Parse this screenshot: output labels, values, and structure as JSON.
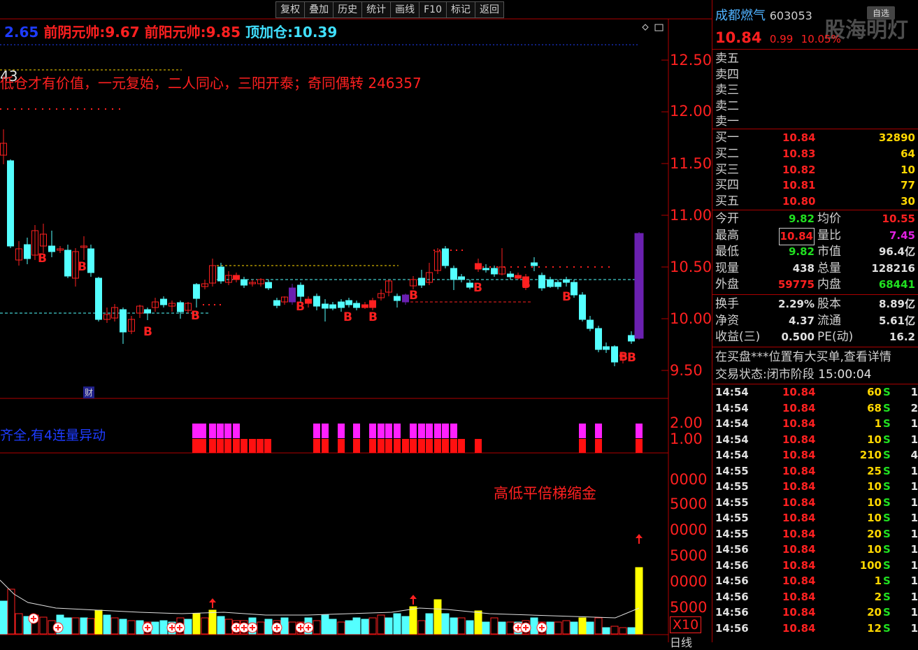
{
  "toolbar": [
    "复权",
    "叠加",
    "历史",
    "统计",
    "画线",
    "F10",
    "标记",
    "返回"
  ],
  "indicator_line": {
    "first_value": "2.65",
    "yin_label": "前阴元帅:",
    "yin_value": "9.67",
    "yang_label": "前阳元帅:",
    "yang_value": "9.85",
    "top_label": "顶加仓:",
    "top_value": "10.39"
  },
  "left_num": "43",
  "note_text": "低仓才有价值，一元复始，二人同心，三阳开泰；奇同偶转 246357",
  "vol_note": "齐全,有4连量异动",
  "gold_label": "高低平倍梯缩金",
  "cai_tag": "财",
  "price_axis": [
    "12.50",
    "12.00",
    "11.50",
    "11.00",
    "10.50",
    "10.00",
    "9.50"
  ],
  "vol_axis": [
    "2.00",
    "1.00"
  ],
  "bottom_axis": [
    "0000",
    "5000",
    "0000",
    "5000",
    "0000",
    "5000"
  ],
  "x10_label": "X10",
  "bottom_partial": "日线",
  "stock": {
    "name": "成都燃气",
    "code": "603053",
    "price": "10.84",
    "change": "0.99",
    "pct": "10.05%",
    "zixuan": "自选",
    "watermark": "股海明灯"
  },
  "sell": [
    "卖五",
    "卖四",
    "卖三",
    "卖二",
    "卖一"
  ],
  "buy": [
    {
      "label": "买一",
      "price": "10.84",
      "vol": "32890"
    },
    {
      "label": "买二",
      "price": "10.83",
      "vol": "64"
    },
    {
      "label": "买三",
      "price": "10.82",
      "vol": "10"
    },
    {
      "label": "买四",
      "price": "10.81",
      "vol": "77"
    },
    {
      "label": "买五",
      "price": "10.80",
      "vol": "30"
    }
  ],
  "stats": [
    {
      "l1": "今开",
      "v1": "9.82",
      "c1": "green",
      "l2": "均价",
      "v2": "10.55",
      "c2": "red"
    },
    {
      "l1": "最高",
      "v1": "10.84",
      "c1": "red",
      "l2": "量比",
      "v2": "7.45",
      "c2": "purple"
    },
    {
      "l1": "最低",
      "v1": "9.82",
      "c1": "green",
      "l2": "市值",
      "v2": "96.4亿",
      "c2": "white"
    },
    {
      "l1": "现量",
      "v1": "438",
      "c1": "white",
      "l2": "总量",
      "v2": "128216",
      "c2": "white"
    },
    {
      "l1": "外盘",
      "v1": "59775",
      "c1": "red",
      "l2": "内盘",
      "v2": "68441",
      "c2": "green"
    }
  ],
  "fund": [
    {
      "l1": "换手",
      "v1": "2.29%",
      "l2": "股本",
      "v2": "8.89亿"
    },
    {
      "l1": "净资",
      "v1": "4.37",
      "l2": "流通",
      "v2": "5.61亿"
    },
    {
      "l1": "收益(三)",
      "v1": "0.500",
      "l2": "PE(动)",
      "v2": "16.2"
    }
  ],
  "notice": "在买盘***位置有大买单,查看详情",
  "trade_status_label": "交易状态:",
  "trade_status": "闭市阶段",
  "trade_time": "15:00:04",
  "ticks": [
    {
      "t": "14:54",
      "p": "10.84",
      "v": "60",
      "s": "S",
      "n": "1"
    },
    {
      "t": "14:54",
      "p": "10.84",
      "v": "68",
      "s": "S",
      "n": "2"
    },
    {
      "t": "14:54",
      "p": "10.84",
      "v": "1",
      "s": "S",
      "n": "1"
    },
    {
      "t": "14:54",
      "p": "10.84",
      "v": "10",
      "s": "S",
      "n": "1"
    },
    {
      "t": "14:54",
      "p": "10.84",
      "v": "210",
      "s": "S",
      "n": "4"
    },
    {
      "t": "14:55",
      "p": "10.84",
      "v": "25",
      "s": "S",
      "n": "1"
    },
    {
      "t": "14:55",
      "p": "10.84",
      "v": "10",
      "s": "S",
      "n": "1"
    },
    {
      "t": "14:55",
      "p": "10.84",
      "v": "10",
      "s": "S",
      "n": "1"
    },
    {
      "t": "14:55",
      "p": "10.84",
      "v": "10",
      "s": "S",
      "n": "1"
    },
    {
      "t": "14:55",
      "p": "10.84",
      "v": "20",
      "s": "S",
      "n": "1"
    },
    {
      "t": "14:56",
      "p": "10.84",
      "v": "10",
      "s": "S",
      "n": "1"
    },
    {
      "t": "14:56",
      "p": "10.84",
      "v": "100",
      "s": "S",
      "n": "1"
    },
    {
      "t": "14:56",
      "p": "10.84",
      "v": "1",
      "s": "S",
      "n": "1"
    },
    {
      "t": "14:56",
      "p": "10.84",
      "v": "2",
      "s": "S",
      "n": "1"
    },
    {
      "t": "14:56",
      "p": "10.84",
      "v": "20",
      "s": "S",
      "n": "1"
    },
    {
      "t": "14:56",
      "p": "10.84",
      "v": "12",
      "s": "S",
      "n": "1"
    }
  ],
  "colors": {
    "up": "#ff2020",
    "down": "#54ffff",
    "panel_line": "#a00",
    "volume_flag": "#ff20ff"
  }
}
